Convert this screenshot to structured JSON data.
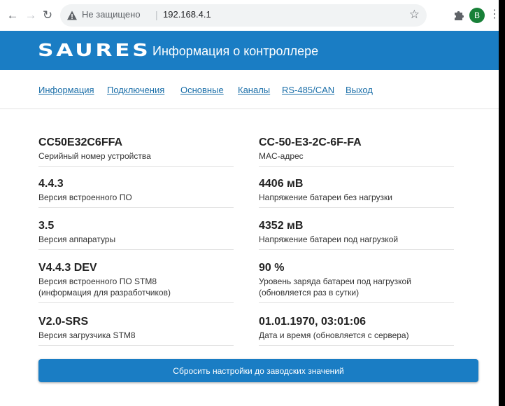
{
  "browser": {
    "security_text": "Не защищено",
    "separator": "|",
    "url": "192.168.4.1",
    "profile_initial": "B"
  },
  "header": {
    "logo": "SAURES",
    "title": "Информация о контроллере",
    "color": "#1a7dc4"
  },
  "tabs": [
    {
      "label": "Информация"
    },
    {
      "label": "Подключения"
    },
    {
      "label": "Основные"
    },
    {
      "label": "Каналы"
    },
    {
      "label": "RS-485/CAN"
    },
    {
      "label": "Выход"
    }
  ],
  "left": [
    {
      "value": "CC50E32C6FFA",
      "label": "Серийный номер устройства"
    },
    {
      "value": "4.4.3",
      "label": "Версия встроенного ПО"
    },
    {
      "value": "3.5",
      "label": "Версия аппаратуры"
    },
    {
      "value": "V4.4.3 DEV",
      "label": "Версия встроенного ПО STM8\n(информация для разработчиков)"
    },
    {
      "value": "V2.0-SRS",
      "label": "Версия загрузчика STM8"
    }
  ],
  "right": [
    {
      "value": "CC-50-E3-2C-6F-FA",
      "label": "MAC-адрес"
    },
    {
      "value": "4406 мВ",
      "label": "Напряжение батареи без нагрузки"
    },
    {
      "value": "4352 мВ",
      "label": "Напряжение батареи под нагрузкой"
    },
    {
      "value": "90 %",
      "label": "Уровень заряда батареи под нагрузкой\n(обновляется раз в сутки)"
    },
    {
      "value": "01.01.1970, 03:01:06",
      "label": "Дата и время (обновляется с сервера)"
    }
  ],
  "reset_button": "Сбросить настройки до заводских значений"
}
